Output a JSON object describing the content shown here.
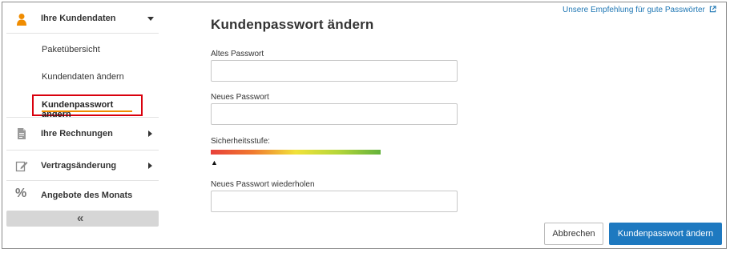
{
  "sidebar": {
    "sections": [
      {
        "label": "Ihre Kundendaten",
        "icon": "person-icon",
        "expanded": true
      },
      {
        "label": "Ihre Rechnungen",
        "icon": "document-icon",
        "expanded": false
      },
      {
        "label": "Vertragsänderung",
        "icon": "edit-icon",
        "expanded": false
      },
      {
        "label": "Angebote des Monats",
        "icon": "percent-icon"
      }
    ],
    "subitems": [
      "Paketübersicht",
      "Kundendaten ändern",
      "Kundenpasswort ändern"
    ],
    "active_subitem": "Kundenpasswort ändern",
    "collapse_glyph": "«"
  },
  "main": {
    "title": "Kundenpasswort ändern",
    "recommendation_link": "Unsere Empfehlung für gute Passwörter",
    "fields": {
      "old_password": {
        "label": "Altes Passwort",
        "value": ""
      },
      "new_password": {
        "label": "Neues Passwort",
        "value": ""
      },
      "strength_label": "Sicherheitsstufe:",
      "strength_marker": "▲",
      "repeat_password": {
        "label": "Neues Passwort wiederholen",
        "value": ""
      }
    },
    "buttons": {
      "cancel": "Abbrechen",
      "submit": "Kundenpasswort ändern"
    }
  },
  "colors": {
    "accent_orange": "#f08c00",
    "highlight_red": "#d9000d",
    "primary_blue": "#1e79c0",
    "link_blue": "#1f77b4"
  }
}
